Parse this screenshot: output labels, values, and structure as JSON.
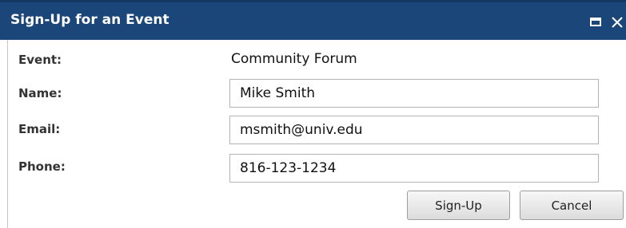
{
  "dialog": {
    "title": "Sign-Up for an Event",
    "icons": {
      "maximize": "maximize-icon",
      "close": "close-icon"
    },
    "close_glyph": "✕"
  },
  "form": {
    "event_label": "Event:",
    "event_value": "Community Forum",
    "name_label": "Name:",
    "name_value": "Mike Smith",
    "email_label": "Email:",
    "email_value": "msmith@univ.edu",
    "phone_label": "Phone:",
    "phone_value": "816-123-1234"
  },
  "buttons": {
    "signup_label": "Sign-Up",
    "cancel_label": "Cancel"
  },
  "colors": {
    "titlebar": "#1a4679",
    "title_text": "#ffffff",
    "label_text": "#333333"
  }
}
